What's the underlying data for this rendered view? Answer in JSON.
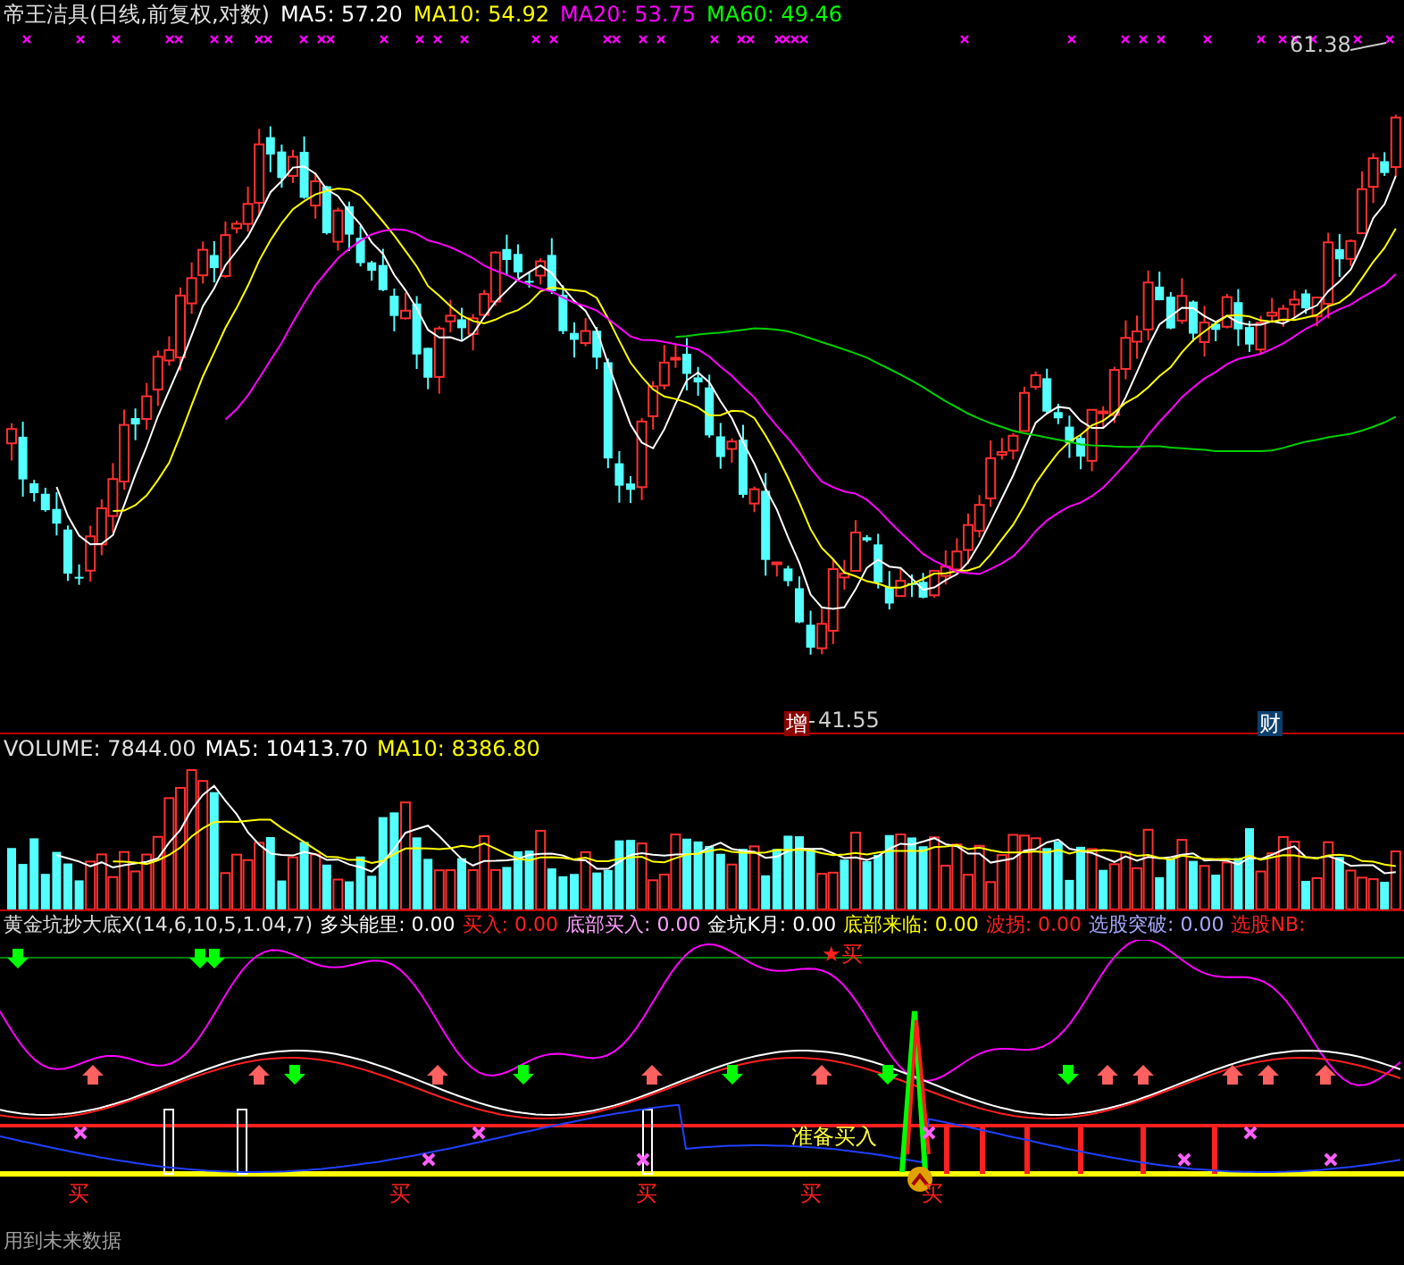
{
  "price_panel": {
    "title": "帝王洁具(日线,前复权,对数)",
    "indicators": [
      {
        "label": "MA5: 57.20",
        "color": "#ffffff"
      },
      {
        "label": "MA10: 54.92",
        "color": "#ffff00"
      },
      {
        "label": "MA20: 53.75",
        "color": "#ff00ff"
      },
      {
        "label": "MA60: 49.46",
        "color": "#00ff00"
      }
    ],
    "high_label": "61.38",
    "low_label": "41.55",
    "badges": [
      {
        "text": "增",
        "color": "#8b0000"
      },
      {
        "text": "财",
        "color": "#0b3f6e"
      }
    ]
  },
  "volume_panel": {
    "title": "VOLUME: 7844.00",
    "indicators": [
      {
        "label": "MA5: 10413.70",
        "color": "#ffffff"
      },
      {
        "label": "MA10: 8386.80",
        "color": "#ffff00"
      }
    ]
  },
  "signal_panel": {
    "title": "黄金坑抄大底X(14,6,10,5,1.04,7)",
    "indicators": [
      {
        "label": "多头能里: 0.00",
        "color": "#ffffff"
      },
      {
        "label": "买入: 0.00",
        "color": "#ff2020"
      },
      {
        "label": "底部买入: 0.00",
        "color": "#ffa0ff"
      },
      {
        "label": "金坑K月: 0.00",
        "color": "#ffffff"
      },
      {
        "label": "底部来临: 0.00",
        "color": "#ffff00"
      },
      {
        "label": "波拐: 0.00",
        "color": "#ff2020"
      },
      {
        "label": "选股突破: 0.00",
        "color": "#a8a8ff"
      },
      {
        "label": "选股NB:",
        "color": "#ff2020"
      }
    ],
    "star_signal": "★买",
    "prepare_label": "准备买入",
    "buy_marks": [
      "买",
      "买",
      "买",
      "买",
      "买"
    ]
  },
  "footer_note": "用到未来数据"
}
